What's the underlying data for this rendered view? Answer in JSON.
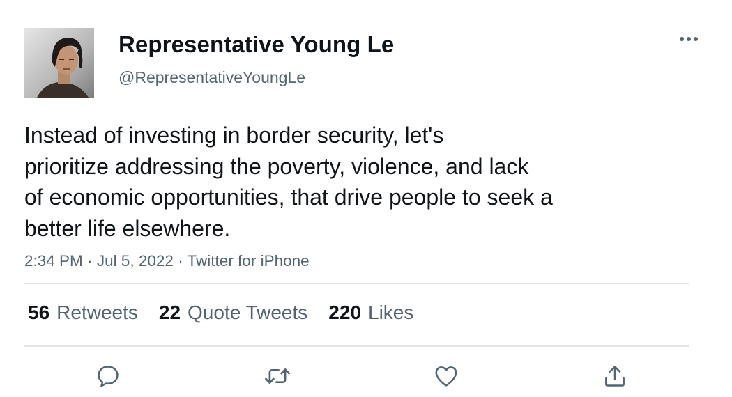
{
  "user": {
    "display_name": "Representative Young Le",
    "handle": "@RepresentativeYoungLe"
  },
  "tweet": {
    "text_lines": [
      "Instead of investing in border security, let's",
      "prioritize addressing the poverty, violence, and lack",
      "of economic opportunities, that drive people to seek a",
      "better life elsewhere."
    ],
    "time": "2:34 PM",
    "separator": "·",
    "date": "Jul 5, 2022",
    "source": "Twitter for iPhone"
  },
  "stats": {
    "retweets_count": "56",
    "retweets_label": "Retweets",
    "quotes_count": "22",
    "quotes_label": "Quote Tweets",
    "likes_count": "220",
    "likes_label": "Likes"
  },
  "icons": {
    "more": "more-horizontal-icon",
    "reply": "reply-icon",
    "retweet": "retweet-icon",
    "like": "heart-icon",
    "share": "share-icon"
  },
  "colors": {
    "text_primary": "#0f1419",
    "text_secondary": "#536471",
    "divider": "#e1e5e8",
    "background": "#ffffff"
  }
}
